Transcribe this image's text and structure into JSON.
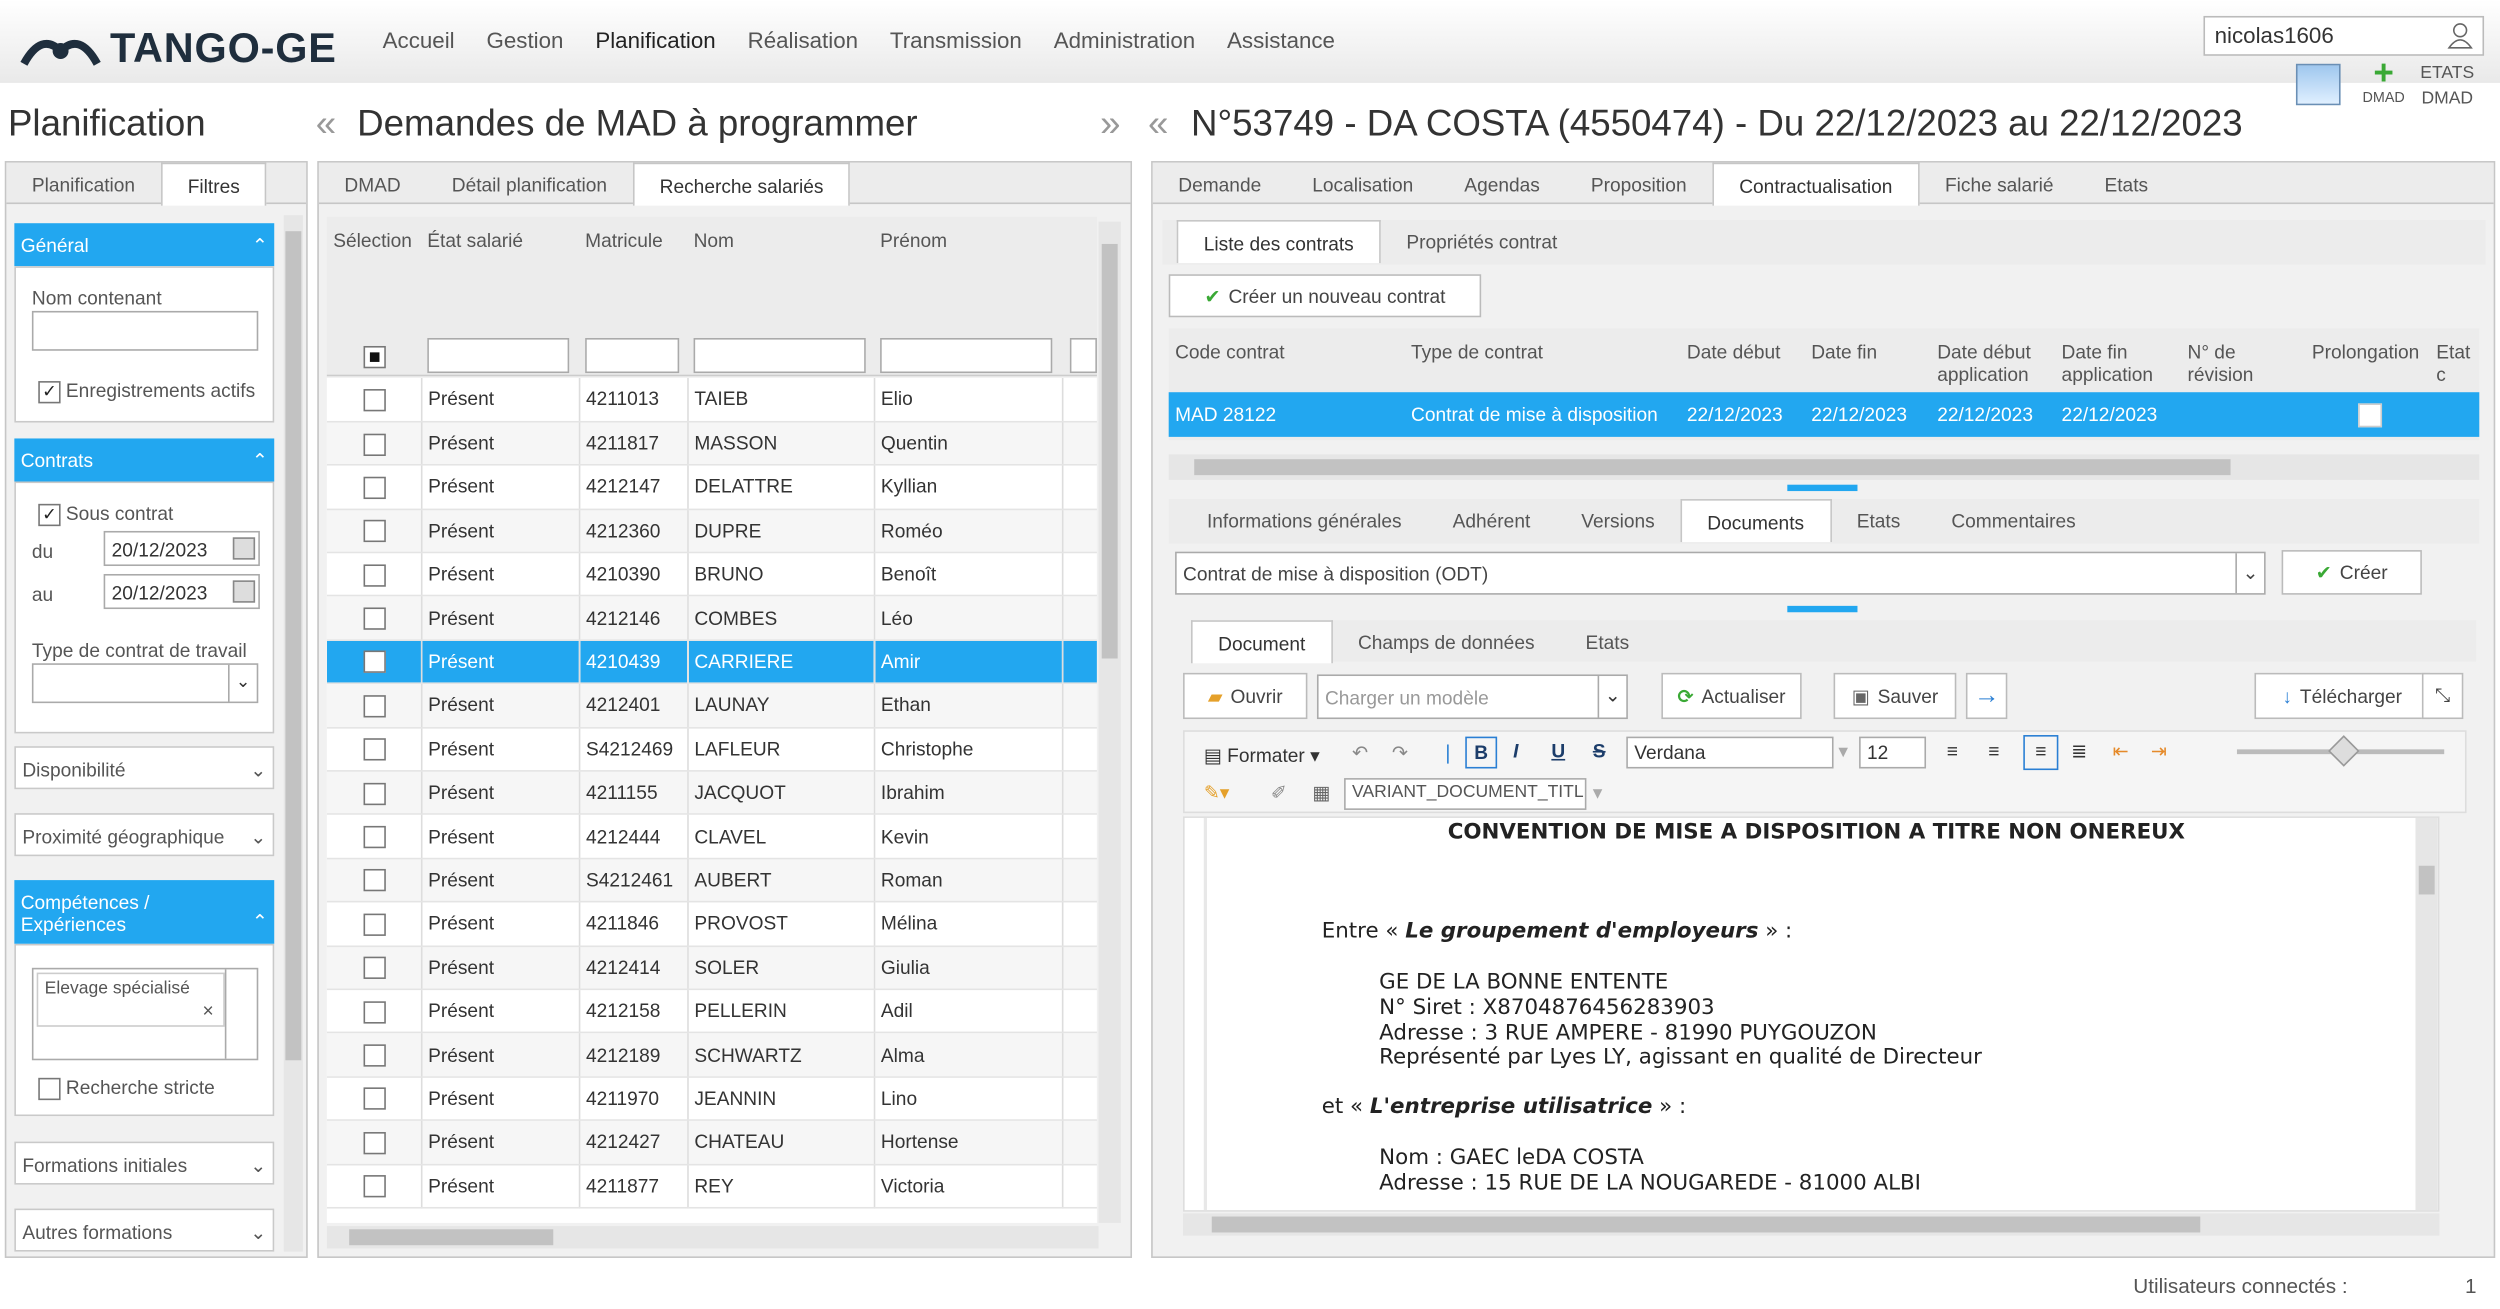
{
  "app": {
    "logo": "TANGO-GE",
    "menu": [
      "Accueil",
      "Gestion",
      "Planification",
      "Réalisation",
      "Transmission",
      "Administration",
      "Assistance"
    ],
    "user": "nicolas1606",
    "dmad_label": "DMAD",
    "etats_dmad": [
      "ETATS",
      "DMAD"
    ]
  },
  "left": {
    "title": "Planification",
    "tabs": [
      "Planification",
      "Filtres"
    ],
    "general": {
      "head": "Général",
      "nom_label": "Nom contenant",
      "nom_value": "",
      "actifs_label": "Enregistrements actifs"
    },
    "contrats": {
      "head": "Contrats",
      "sous_contrat": "Sous contrat",
      "du_label": "du",
      "du_value": "20/12/2023",
      "au_label": "au",
      "au_value": "20/12/2023",
      "type_label": "Type de contrat de travail"
    },
    "disponibilite": "Disponibilité",
    "proximite": "Proximité géographique",
    "competences": {
      "head": "Compétences / Expériences",
      "tag": "Elevage spécialisé",
      "stricte": "Recherche stricte"
    },
    "formations": "Formations initiales",
    "autres": "Autres formations"
  },
  "middle": {
    "title": "Demandes de MAD à programmer",
    "tabs": [
      "DMAD",
      "Détail planification",
      "Recherche salariés"
    ],
    "columns": [
      "Sélection",
      "État salarié",
      "Matricule",
      "Nom",
      "Prénom"
    ],
    "rows": [
      [
        "Présent",
        "4211013",
        "TAIEB",
        "Elio"
      ],
      [
        "Présent",
        "4211817",
        "MASSON",
        "Quentin"
      ],
      [
        "Présent",
        "4212147",
        "DELATTRE",
        "Kyllian"
      ],
      [
        "Présent",
        "4212360",
        "DUPRE",
        "Roméo"
      ],
      [
        "Présent",
        "4210390",
        "BRUNO",
        "Benoît"
      ],
      [
        "Présent",
        "4212146",
        "COMBES",
        "Léo"
      ],
      [
        "Présent",
        "4210439",
        "CARRIERE",
        "Amir"
      ],
      [
        "Présent",
        "4212401",
        "LAUNAY",
        "Ethan"
      ],
      [
        "Présent",
        "S4212469",
        "LAFLEUR",
        "Christophe"
      ],
      [
        "Présent",
        "4211155",
        "JACQUOT",
        "Ibrahim"
      ],
      [
        "Présent",
        "4212444",
        "CLAVEL",
        "Kevin"
      ],
      [
        "Présent",
        "S4212461",
        "AUBERT",
        "Roman"
      ],
      [
        "Présent",
        "4211846",
        "PROVOST",
        "Mélina"
      ],
      [
        "Présent",
        "4212414",
        "SOLER",
        "Giulia"
      ],
      [
        "Présent",
        "4212158",
        "PELLERIN",
        "Adil"
      ],
      [
        "Présent",
        "4212189",
        "SCHWARTZ",
        "Alma"
      ],
      [
        "Présent",
        "4211970",
        "JEANNIN",
        "Lino"
      ],
      [
        "Présent",
        "4212427",
        "CHATEAU",
        "Hortense"
      ],
      [
        "Présent",
        "4211877",
        "REY",
        "Victoria"
      ]
    ],
    "selected_index": 6
  },
  "right": {
    "title": "N°53749 - DA COSTA (4550474) - Du 22/12/2023 au 22/12/2023",
    "tabs": [
      "Demande",
      "Localisation",
      "Agendas",
      "Proposition",
      "Contractualisation",
      "Fiche salarié",
      "Etats"
    ],
    "subtabs": [
      "Liste des contrats",
      "Propriétés contrat"
    ],
    "new_contract": "Créer un nouveau contrat",
    "contract_cols": [
      "Code contrat",
      "Type de contrat",
      "Date début",
      "Date fin",
      "Date début application",
      "Date fin application",
      "N° de révision",
      "Prolongation",
      "Etat c"
    ],
    "contract_row": [
      "MAD 28122",
      "Contrat de mise à disposition",
      "22/12/2023",
      "22/12/2023",
      "22/12/2023",
      "22/12/2023"
    ],
    "doc_tabs": [
      "Informations générales",
      "Adhérent",
      "Versions",
      "Documents",
      "Etats",
      "Commentaires"
    ],
    "model_select": "Contrat de mise à disposition (ODT)",
    "create": "Créer",
    "editor_tabs": [
      "Document",
      "Champs de données",
      "Etats"
    ],
    "buttons": {
      "open": "Ouvrir",
      "model_ph": "Charger un modèle",
      "refresh": "Actualiser",
      "save": "Sauver",
      "download": "Télécharger"
    },
    "format": {
      "formater": "Formater",
      "font": "Verdana",
      "size": "12",
      "variant": "VARIANT_DOCUMENT_TITLE"
    },
    "doc": {
      "heading": "CONVENTION DE MISE A DISPOSITION A TITRE NON ONEREUX",
      "entre_pre": "Entre « ",
      "entre_em": "Le groupement d'employeurs",
      "entre_post": " » :",
      "l1": "GE DE LA BONNE ENTENTE",
      "l2": "N° Siret : X8704876456283903",
      "l3": "Adresse : 3 RUE AMPERE - 81990 PUYGOUZON",
      "l4": "Représenté par Lyes LY, agissant en qualité de Directeur",
      "et_pre": "et « ",
      "et_em": "L'entreprise utilisatrice",
      "et_post": " » :",
      "l5": "Nom : GAEC leDA COSTA",
      "l6": "Adresse : 15 RUE DE LA NOUGAREDE - 81000  ALBI"
    }
  },
  "footer": {
    "label": "Utilisateurs connectés :",
    "count": "1"
  }
}
